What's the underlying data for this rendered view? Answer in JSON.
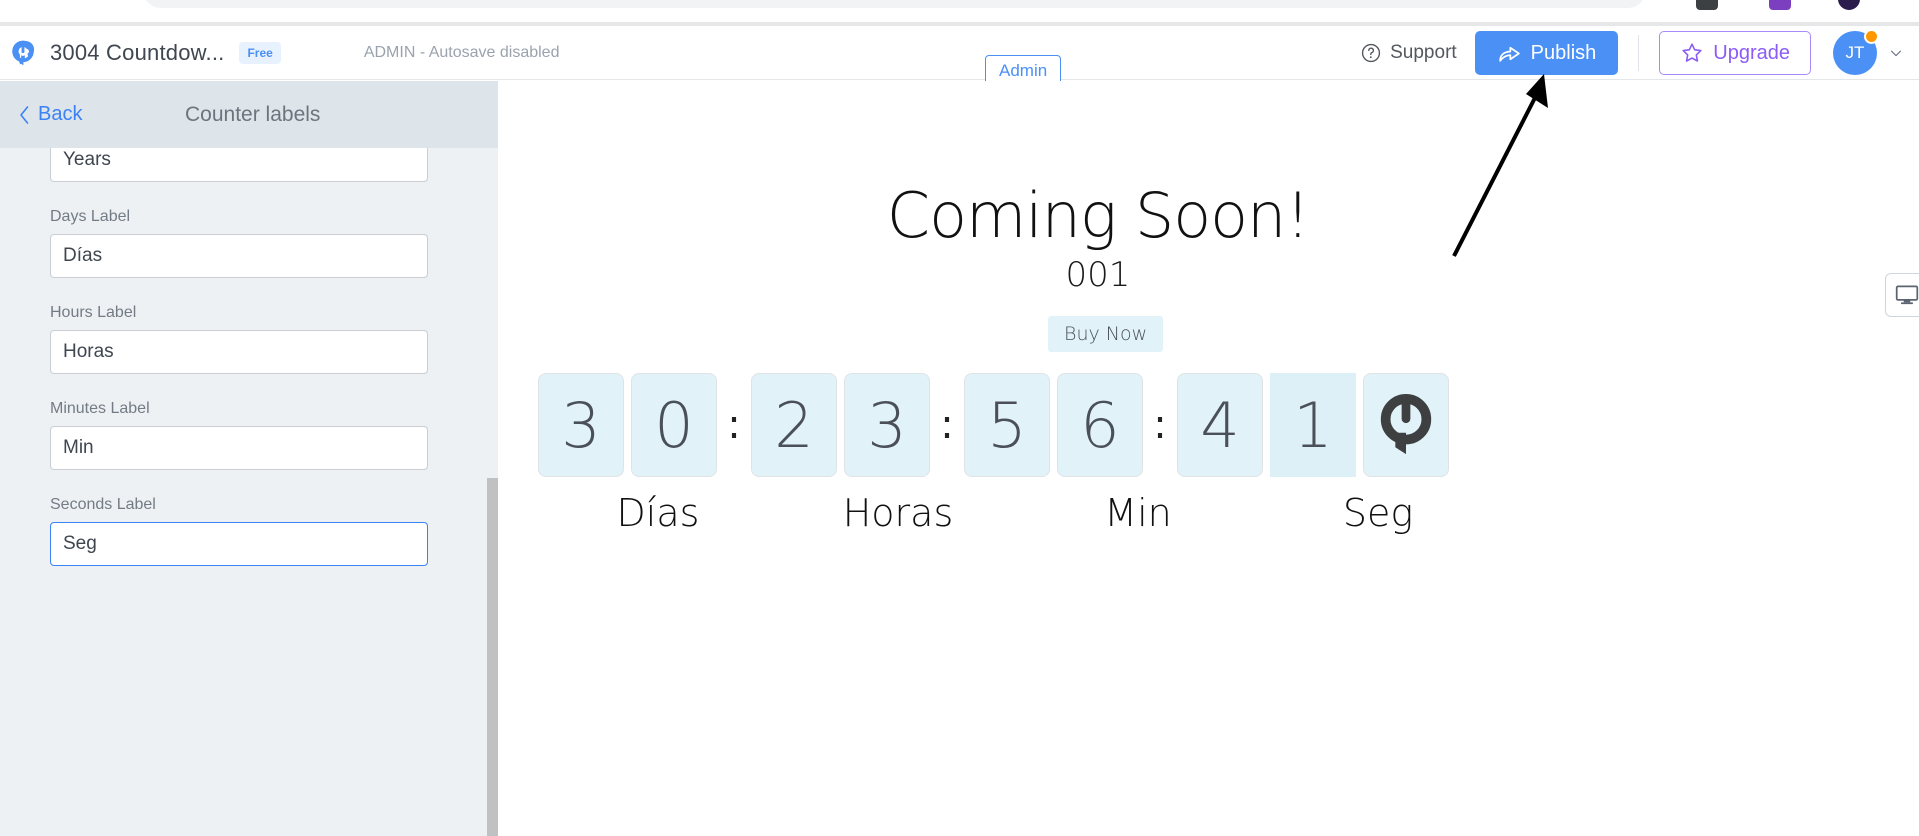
{
  "browser": {
    "extension_icons": [
      "extension-dark-icon",
      "extension-purple-icon",
      "extension-avatar-icon"
    ]
  },
  "header": {
    "logo_icon": "power-logo-icon",
    "project_title": "3004 Countdow...",
    "plan_badge": "Free",
    "autosave_status": "ADMIN - Autosave disabled",
    "admin_pill": "Admin",
    "support_label": "Support",
    "support_icon": "question-circle-icon",
    "publish_label": "Publish",
    "publish_icon": "share-arrow-icon",
    "upgrade_label": "Upgrade",
    "upgrade_icon": "star-icon",
    "avatar_initials": "JT",
    "avatar_caret_icon": "chevron-down-icon",
    "colors": {
      "primary": "#4a90f5",
      "upgrade": "#8b5cf6",
      "badge_bg": "#e8f1fe",
      "avatar_badge": "#ff9800"
    }
  },
  "sidebar": {
    "back_label": "Back",
    "back_icon": "chevron-left-icon",
    "panel_title": "Counter labels",
    "fields": [
      {
        "label": "",
        "value": "Years",
        "focused": false,
        "name": "years-label-field"
      },
      {
        "label": "Days Label",
        "value": "Días",
        "focused": false,
        "name": "days-label-field"
      },
      {
        "label": "Hours Label",
        "value": "Horas",
        "focused": false,
        "name": "hours-label-field"
      },
      {
        "label": "Minutes Label",
        "value": "Min",
        "focused": false,
        "name": "minutes-label-field"
      },
      {
        "label": "Seconds Label",
        "value": "Seg",
        "focused": true,
        "name": "seconds-label-field"
      }
    ],
    "scrollbar": "vertical-scrollbar"
  },
  "preview": {
    "heading": "Coming Soon!",
    "counter_code": "001",
    "buy_now_label": "Buy Now",
    "countdown": {
      "groups": [
        {
          "unit": "Días",
          "digits": [
            "3",
            "0"
          ]
        },
        {
          "unit": "Horas",
          "digits": [
            "2",
            "3"
          ]
        },
        {
          "unit": "Min",
          "digits": [
            "5",
            "6"
          ]
        },
        {
          "unit": "Seg",
          "digits": [
            "4",
            "1"
          ]
        }
      ],
      "separator": ":",
      "extra_tile_icon": "power-logo-icon",
      "tile_bg": "#e1f3f8",
      "tile_text": "#4b5058"
    },
    "device_toggle_icon": "desktop-monitor-icon",
    "annotation": "arrow-pointing-to-publish"
  }
}
